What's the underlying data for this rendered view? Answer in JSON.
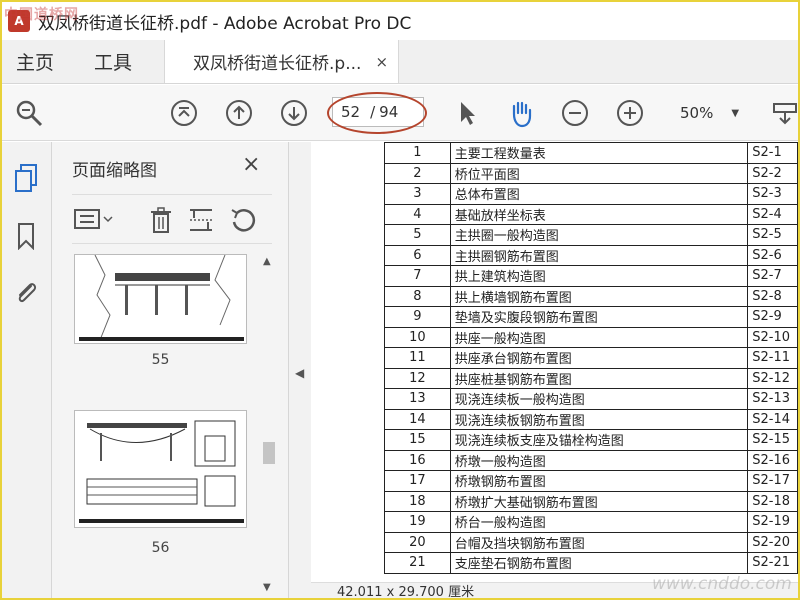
{
  "window": {
    "title": "双凤桥街道长征桥.pdf - Adobe Acrobat Pro DC",
    "app_icon": "acrobat-icon"
  },
  "tabs": {
    "home": "主页",
    "tools": "工具",
    "document": "双凤桥街道长征桥.p...",
    "close": "×"
  },
  "toolbar": {
    "current_page": "52",
    "page_separator": "/",
    "total_pages": "94",
    "zoom": "50%",
    "annotation_color": "#b5452d"
  },
  "sidebar": {
    "items": [
      "pages-icon",
      "bookmark-icon",
      "attachment-icon"
    ]
  },
  "thumbnail_panel": {
    "title": "页面缩略图",
    "close": "×",
    "pages": [
      {
        "number": "55"
      },
      {
        "number": "56"
      }
    ]
  },
  "table": {
    "rows": [
      {
        "num": "1",
        "title": "主要工程数量表",
        "code": "S2-1"
      },
      {
        "num": "2",
        "title": "桥位平面图",
        "code": "S2-2"
      },
      {
        "num": "3",
        "title": "总体布置图",
        "code": "S2-3"
      },
      {
        "num": "4",
        "title": "基础放样坐标表",
        "code": "S2-4"
      },
      {
        "num": "5",
        "title": "主拱圈一般构造图",
        "code": "S2-5"
      },
      {
        "num": "6",
        "title": "主拱圈钢筋布置图",
        "code": "S2-6"
      },
      {
        "num": "7",
        "title": "拱上建筑构造图",
        "code": "S2-7"
      },
      {
        "num": "8",
        "title": "拱上横墙钢筋布置图",
        "code": "S2-8"
      },
      {
        "num": "9",
        "title": "垫墙及实腹段钢筋布置图",
        "code": "S2-9"
      },
      {
        "num": "10",
        "title": "拱座一般构造图",
        "code": "S2-10"
      },
      {
        "num": "11",
        "title": "拱座承台钢筋布置图",
        "code": "S2-11"
      },
      {
        "num": "12",
        "title": "拱座桩基钢筋布置图",
        "code": "S2-12"
      },
      {
        "num": "13",
        "title": "现浇连续板一般构造图",
        "code": "S2-13"
      },
      {
        "num": "14",
        "title": "现浇连续板钢筋布置图",
        "code": "S2-14"
      },
      {
        "num": "15",
        "title": "现浇连续板支座及锚栓构造图",
        "code": "S2-15"
      },
      {
        "num": "16",
        "title": "桥墩一般构造图",
        "code": "S2-16"
      },
      {
        "num": "17",
        "title": "桥墩钢筋布置图",
        "code": "S2-17"
      },
      {
        "num": "18",
        "title": "桥墩扩大基础钢筋布置图",
        "code": "S2-18"
      },
      {
        "num": "19",
        "title": "桥台一般构造图",
        "code": "S2-19"
      },
      {
        "num": "20",
        "title": "台帽及挡块钢筋布置图",
        "code": "S2-20"
      },
      {
        "num": "21",
        "title": "支座垫石钢筋布置图",
        "code": "S2-21"
      }
    ]
  },
  "status": {
    "page_size": "42.011 x 29.700 厘米"
  },
  "watermarks": {
    "top_left": "中国道桥网",
    "bottom_right": "www.cnddo.com"
  }
}
